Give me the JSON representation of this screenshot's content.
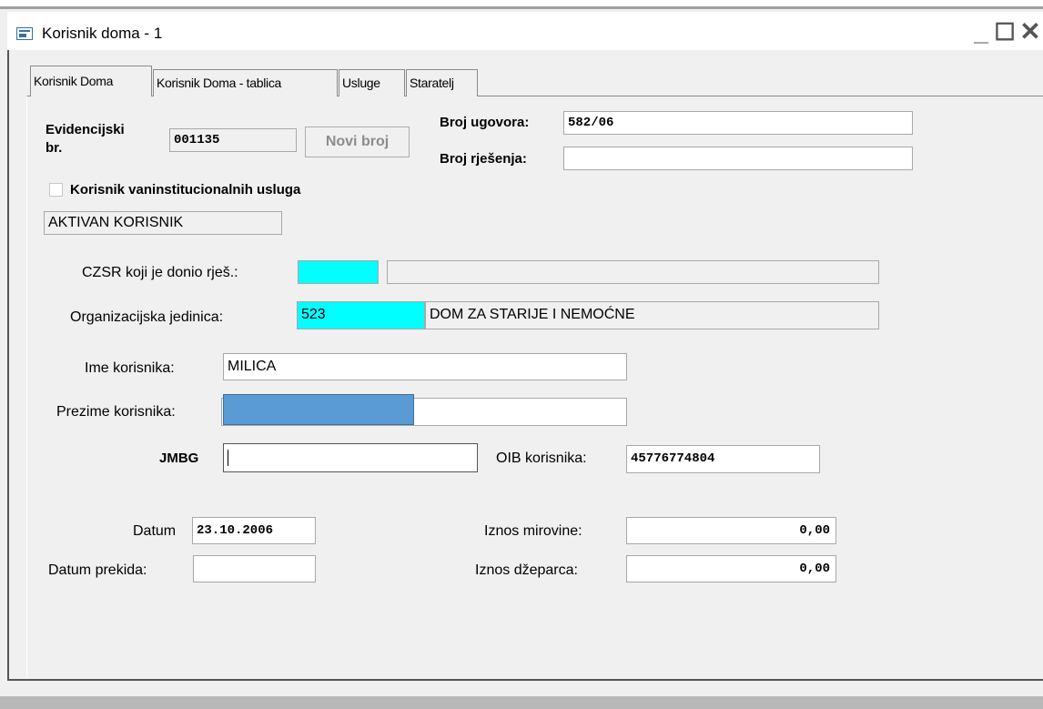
{
  "window": {
    "title": "Korisnik doma - 1",
    "icon": "window-form-icon",
    "minimize_glyph": "_",
    "maximize_glyph": "☐",
    "close_glyph": "✕"
  },
  "tabs": [
    {
      "label": "Korisnik Doma",
      "active": true
    },
    {
      "label": "Korisnik Doma - tablica",
      "active": false
    },
    {
      "label": "Usluge",
      "active": false
    },
    {
      "label": "Staratelj",
      "active": false
    }
  ],
  "form": {
    "evidencijski_label_line1": "Evidencijski",
    "evidencijski_label_line2": "br.",
    "evidencijski_value": "001135",
    "novi_broj_button": "Novi broj",
    "broj_ugovora_label": "Broj ugovora:",
    "broj_ugovora_value": "582/06",
    "broj_rjesenja_label": "Broj rješenja:",
    "broj_rjesenja_value": "",
    "vaninstitucionalni_label": "Korisnik vaninstitucionalnih usluga",
    "vaninstitucionalni_checked": false,
    "status_value": "AKTIVAN KORISNIK",
    "czsr_label": "CZSR koji je donio rješ.:",
    "czsr_code": "",
    "czsr_name": "",
    "org_label": "Organizacijska jedinica:",
    "org_code": "523",
    "org_name": "DOM ZA STARIJE I NEMOĆNE",
    "ime_label": "Ime korisnika:",
    "ime_value": "MILICA",
    "prezime_label": "Prezime korisnika:",
    "prezime_value": "",
    "jmbg_label": "JMBG",
    "jmbg_value": "",
    "oib_label": "OIB korisnika:",
    "oib_value": "45776774804",
    "datum_label": "Datum",
    "datum_value": "23.10.2006",
    "datum_prekida_label": "Datum prekida:",
    "datum_prekida_value": "",
    "iznos_mirovine_label": "Iznos mirovine:",
    "iznos_mirovine_value": "0,00",
    "iznos_dzeparca_label": "Iznos džeparca:",
    "iznos_dzeparca_value": "0,00"
  },
  "colors": {
    "lookup_code_bg": "#00ffff",
    "redacted_block": "#5b9bd5"
  }
}
